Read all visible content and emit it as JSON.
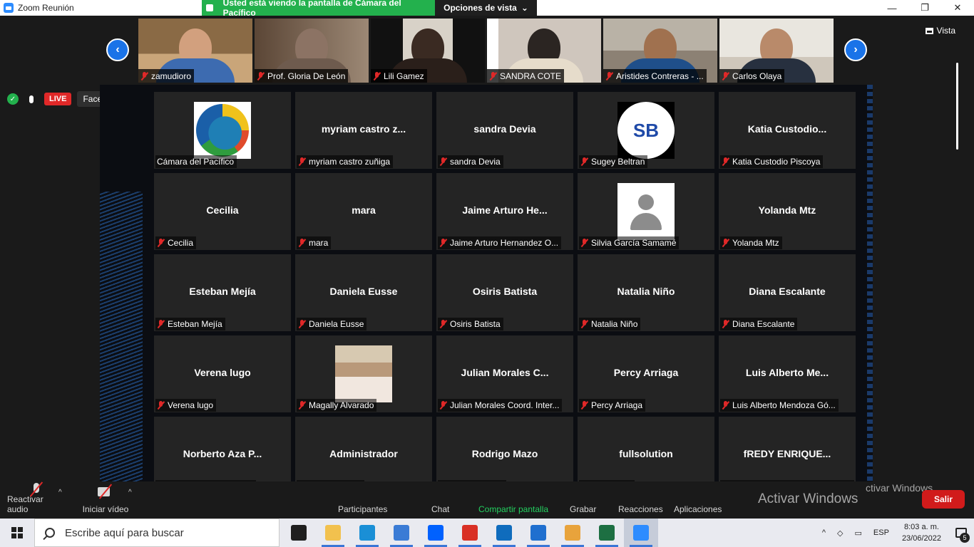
{
  "window": {
    "title": "Zoom Reunión",
    "minimize": "—",
    "maximize": "❐",
    "close": "✕"
  },
  "share_banner": {
    "message": "Usted está viendo la pantalla de Cámara del Pacífico",
    "options_label": "Opciones de vista",
    "options_caret": "⌄"
  },
  "view_button": {
    "label": "Vista"
  },
  "thumbnails": [
    {
      "name": "zamudioro"
    },
    {
      "name": "Prof. Gloria De León"
    },
    {
      "name": "Lili Gamez"
    },
    {
      "name": "SANDRA COTE"
    },
    {
      "name": "Aristides Contreras - ..."
    },
    {
      "name": "Carlos Olaya"
    }
  ],
  "nav": {
    "prev": "‹",
    "next": "›"
  },
  "stream": {
    "live_label": "LIVE",
    "platform": "Facebook",
    "platform_caret": "▾",
    "shield_glyph": "✓"
  },
  "grid": [
    {
      "tile_text": "",
      "name": "Cámara del Pacífico",
      "muted": false,
      "picture": "logo-camara"
    },
    {
      "tile_text": "myriam castro z...",
      "name": "myriam castro zuñiga",
      "muted": true
    },
    {
      "tile_text": "sandra Devia",
      "name": "sandra Devia",
      "muted": true
    },
    {
      "tile_text": "",
      "name": "Sugey Beltran",
      "muted": true,
      "picture": "logo-sb",
      "logo_text": "SB"
    },
    {
      "tile_text": "Katia Custodio...",
      "name": "Katia Custodio Piscoya",
      "muted": true
    },
    {
      "tile_text": "Cecilia",
      "name": "Cecilia",
      "muted": true
    },
    {
      "tile_text": "mara",
      "name": "mara",
      "muted": true
    },
    {
      "tile_text": "Jaime Arturo He...",
      "name": "Jaime Arturo Hernandez O...",
      "muted": true
    },
    {
      "tile_text": "",
      "name": "Silvia García Samamé",
      "muted": true,
      "picture": "default-avatar"
    },
    {
      "tile_text": "Yolanda Mtz",
      "name": "Yolanda Mtz",
      "muted": true
    },
    {
      "tile_text": "Esteban Mejía",
      "name": "Esteban Mejía",
      "muted": true
    },
    {
      "tile_text": "Daniela Eusse",
      "name": "Daniela Eusse",
      "muted": true
    },
    {
      "tile_text": "Osiris Batista",
      "name": "Osiris Batista",
      "muted": true
    },
    {
      "tile_text": "Natalia Niño",
      "name": "Natalia Niño",
      "muted": true
    },
    {
      "tile_text": "Diana Escalante",
      "name": "Diana Escalante",
      "muted": true
    },
    {
      "tile_text": "Verena lugo",
      "name": "Verena lugo",
      "muted": true
    },
    {
      "tile_text": "",
      "name": "Magally Alvarado",
      "muted": true,
      "picture": "photo"
    },
    {
      "tile_text": "Julian Morales C...",
      "name": "Julian Morales Coord. Inter...",
      "muted": true
    },
    {
      "tile_text": "Percy Arriaga",
      "name": "Percy Arriaga",
      "muted": true
    },
    {
      "tile_text": "Luis Alberto Me...",
      "name": "Luis Alberto Mendoza Gó...",
      "muted": true
    },
    {
      "tile_text": "Norberto Aza P...",
      "name": "Norberto Aza Pacheco",
      "muted": true
    },
    {
      "tile_text": "Administrador",
      "name": "Administrador",
      "muted": true
    },
    {
      "tile_text": "Rodrigo Mazo",
      "name": "Rodrigo Mazo",
      "muted": true
    },
    {
      "tile_text": "fullsolution",
      "name": "fullsolution",
      "muted": true
    },
    {
      "tile_text": "fREDY ENRIQUE...",
      "name": "fREDY ENRIQUE PEÑA BERMU...",
      "muted": false
    }
  ],
  "meeting_controls": {
    "audio": "Reactivar audio",
    "video": "Iniciar vídeo",
    "caret": "^",
    "participants": "Participantes",
    "chat": "Chat",
    "share": "Compartir pantalla",
    "record": "Grabar",
    "reactions": "Reacciones",
    "apps": "Aplicaciones",
    "leave": "Salir"
  },
  "watermark": {
    "line1": "ctivar Windows",
    "line2": "Activar Windows"
  },
  "taskbar": {
    "search_placeholder": "Escribe aquí para buscar",
    "apps": [
      {
        "icon": "shield-app-icon",
        "color": "#1f1f1f"
      },
      {
        "icon": "file-explorer-icon",
        "color": "#f2c14e"
      },
      {
        "icon": "edge-icon",
        "color": "#1a8fd6"
      },
      {
        "icon": "store-icon",
        "color": "#3a7bd5"
      },
      {
        "icon": "dropbox-icon",
        "color": "#0061fe"
      },
      {
        "icon": "chrome-icon",
        "color": "#d93025"
      },
      {
        "icon": "outlook-app-icon",
        "color": "#0f6cbd"
      },
      {
        "icon": "mail-icon",
        "color": "#1f6fcf"
      },
      {
        "icon": "paint-icon",
        "color": "#e8a33c"
      },
      {
        "icon": "excel-icon",
        "color": "#1d6f42"
      },
      {
        "icon": "zoom-icon",
        "color": "#2d8cff"
      }
    ],
    "tray": {
      "chevron": "^",
      "lang": "ESP",
      "time": "8:03 a. m.",
      "date": "23/06/2022",
      "notifications": "5"
    }
  },
  "colors": {
    "accent_blue": "#1a73e8",
    "live_red": "#e02828",
    "share_green": "#23b14d",
    "leave_red": "#d11b1b",
    "tile_bg": "#242424"
  }
}
